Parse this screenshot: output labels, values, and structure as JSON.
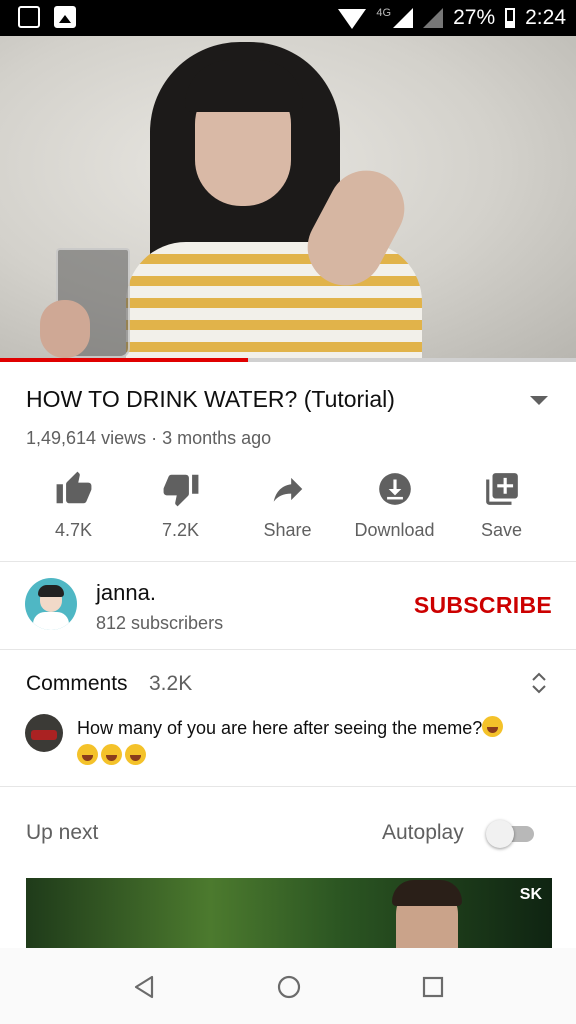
{
  "status_bar": {
    "network": "4G",
    "battery": "27%",
    "time": "2:24",
    "icons": [
      "cast-screen-icon",
      "image-notification-icon",
      "wifi-icon",
      "signal-icon",
      "signal-empty-icon",
      "battery-icon"
    ]
  },
  "video": {
    "progress_fraction": 0.43,
    "progress_color": "#e00000"
  },
  "video_info": {
    "title": "HOW TO DRINK WATER? (Tutorial)",
    "meta": "1,49,614 views · 3 months ago"
  },
  "actions": [
    {
      "icon": "thumbs-up-icon",
      "label": "4.7K"
    },
    {
      "icon": "thumbs-down-icon",
      "label": "7.2K"
    },
    {
      "icon": "share-icon",
      "label": "Share"
    },
    {
      "icon": "download-icon",
      "label": "Download"
    },
    {
      "icon": "save-playlist-icon",
      "label": "Save"
    }
  ],
  "channel": {
    "name": "janna.",
    "subscribers": "812 subscribers",
    "subscribe_label": "SUBSCRIBE",
    "accent_color": "#cc0000"
  },
  "comments": {
    "title": "Comments",
    "count": "3.2K",
    "top_comment": "How many of you are here after seeing the meme?"
  },
  "up_next": {
    "label": "Up next",
    "autoplay_label": "Autoplay",
    "autoplay_on": false,
    "thumb_badge": "SK"
  },
  "nav": {
    "icons": [
      "back-icon",
      "home-icon",
      "recents-icon"
    ]
  }
}
